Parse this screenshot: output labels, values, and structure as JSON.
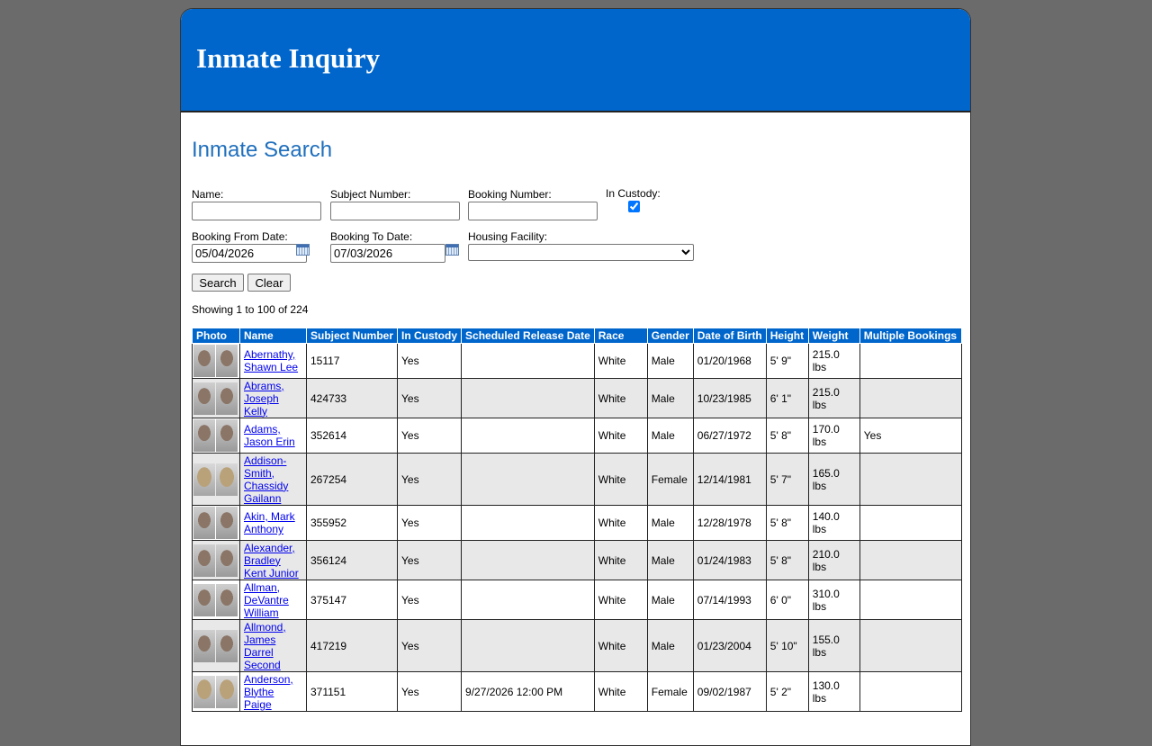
{
  "header": {
    "title": "Inmate Inquiry"
  },
  "search": {
    "title": "Inmate Search",
    "name_label": "Name:",
    "name_value": "",
    "subject_label": "Subject Number:",
    "subject_value": "",
    "booking_label": "Booking Number:",
    "booking_value": "",
    "custody_label": "In Custody:",
    "custody_checked": true,
    "from_label": "Booking From Date:",
    "from_value": "05/04/2026",
    "to_label": "Booking To Date:",
    "to_value": "07/03/2026",
    "facility_label": "Housing Facility:",
    "facility_value": "",
    "search_button": "Search",
    "clear_button": "Clear"
  },
  "results": {
    "showing": "Showing 1 to 100 of 224",
    "columns": [
      "Photo",
      "Name",
      "Subject Number",
      "In Custody",
      "Scheduled Release Date",
      "Race",
      "Gender",
      "Date of Birth",
      "Height",
      "Weight",
      "Multiple Bookings"
    ],
    "rows": [
      {
        "name": [
          "Abernathy,",
          "Shawn Lee"
        ],
        "subject": "15117",
        "custody": "Yes",
        "release": "",
        "race": "White",
        "gender": "Male",
        "dob": "01/20/1968",
        "height": "5' 9\"",
        "weight": "215.0 lbs",
        "multiple": "",
        "photo": "m"
      },
      {
        "name": [
          "Abrams,",
          "Joseph",
          "Kelly"
        ],
        "subject": "424733",
        "custody": "Yes",
        "release": "",
        "race": "White",
        "gender": "Male",
        "dob": "10/23/1985",
        "height": "6' 1\"",
        "weight": "215.0 lbs",
        "multiple": "",
        "photo": "m"
      },
      {
        "name": [
          "Adams,",
          "Jason Erin"
        ],
        "subject": "352614",
        "custody": "Yes",
        "release": "",
        "race": "White",
        "gender": "Male",
        "dob": "06/27/1972",
        "height": "5' 8\"",
        "weight": "170.0 lbs",
        "multiple": "Yes",
        "photo": "m"
      },
      {
        "name": [
          "Addison-",
          "Smith,",
          "Chassidy",
          "Gailann"
        ],
        "subject": "267254",
        "custody": "Yes",
        "release": "",
        "race": "White",
        "gender": "Female",
        "dob": "12/14/1981",
        "height": "5' 7\"",
        "weight": "165.0 lbs",
        "multiple": "",
        "photo": "f"
      },
      {
        "name": [
          "Akin, Mark",
          "Anthony"
        ],
        "subject": "355952",
        "custody": "Yes",
        "release": "",
        "race": "White",
        "gender": "Male",
        "dob": "12/28/1978",
        "height": "5' 8\"",
        "weight": "140.0 lbs",
        "multiple": "",
        "photo": "m"
      },
      {
        "name": [
          "Alexander,",
          "Bradley",
          "Kent Junior"
        ],
        "subject": "356124",
        "custody": "Yes",
        "release": "",
        "race": "White",
        "gender": "Male",
        "dob": "01/24/1983",
        "height": "5' 8\"",
        "weight": "210.0 lbs",
        "multiple": "",
        "photo": "m"
      },
      {
        "name": [
          "Allman,",
          "DeVantre",
          "William"
        ],
        "subject": "375147",
        "custody": "Yes",
        "release": "",
        "race": "White",
        "gender": "Male",
        "dob": "07/14/1993",
        "height": "6' 0\"",
        "weight": "310.0 lbs",
        "multiple": "",
        "photo": "m"
      },
      {
        "name": [
          "Allmond,",
          "James",
          "Darrel",
          "Second"
        ],
        "subject": "417219",
        "custody": "Yes",
        "release": "",
        "race": "White",
        "gender": "Male",
        "dob": "01/23/2004",
        "height": "5' 10\"",
        "weight": "155.0 lbs",
        "multiple": "",
        "photo": "m"
      },
      {
        "name": [
          "Anderson,",
          "Blythe",
          "Paige"
        ],
        "subject": "371151",
        "custody": "Yes",
        "release": "9/27/2026 12:00 PM",
        "race": "White",
        "gender": "Female",
        "dob": "09/02/1987",
        "height": "5' 2\"",
        "weight": "130.0 lbs",
        "multiple": "",
        "photo": "f"
      }
    ]
  }
}
